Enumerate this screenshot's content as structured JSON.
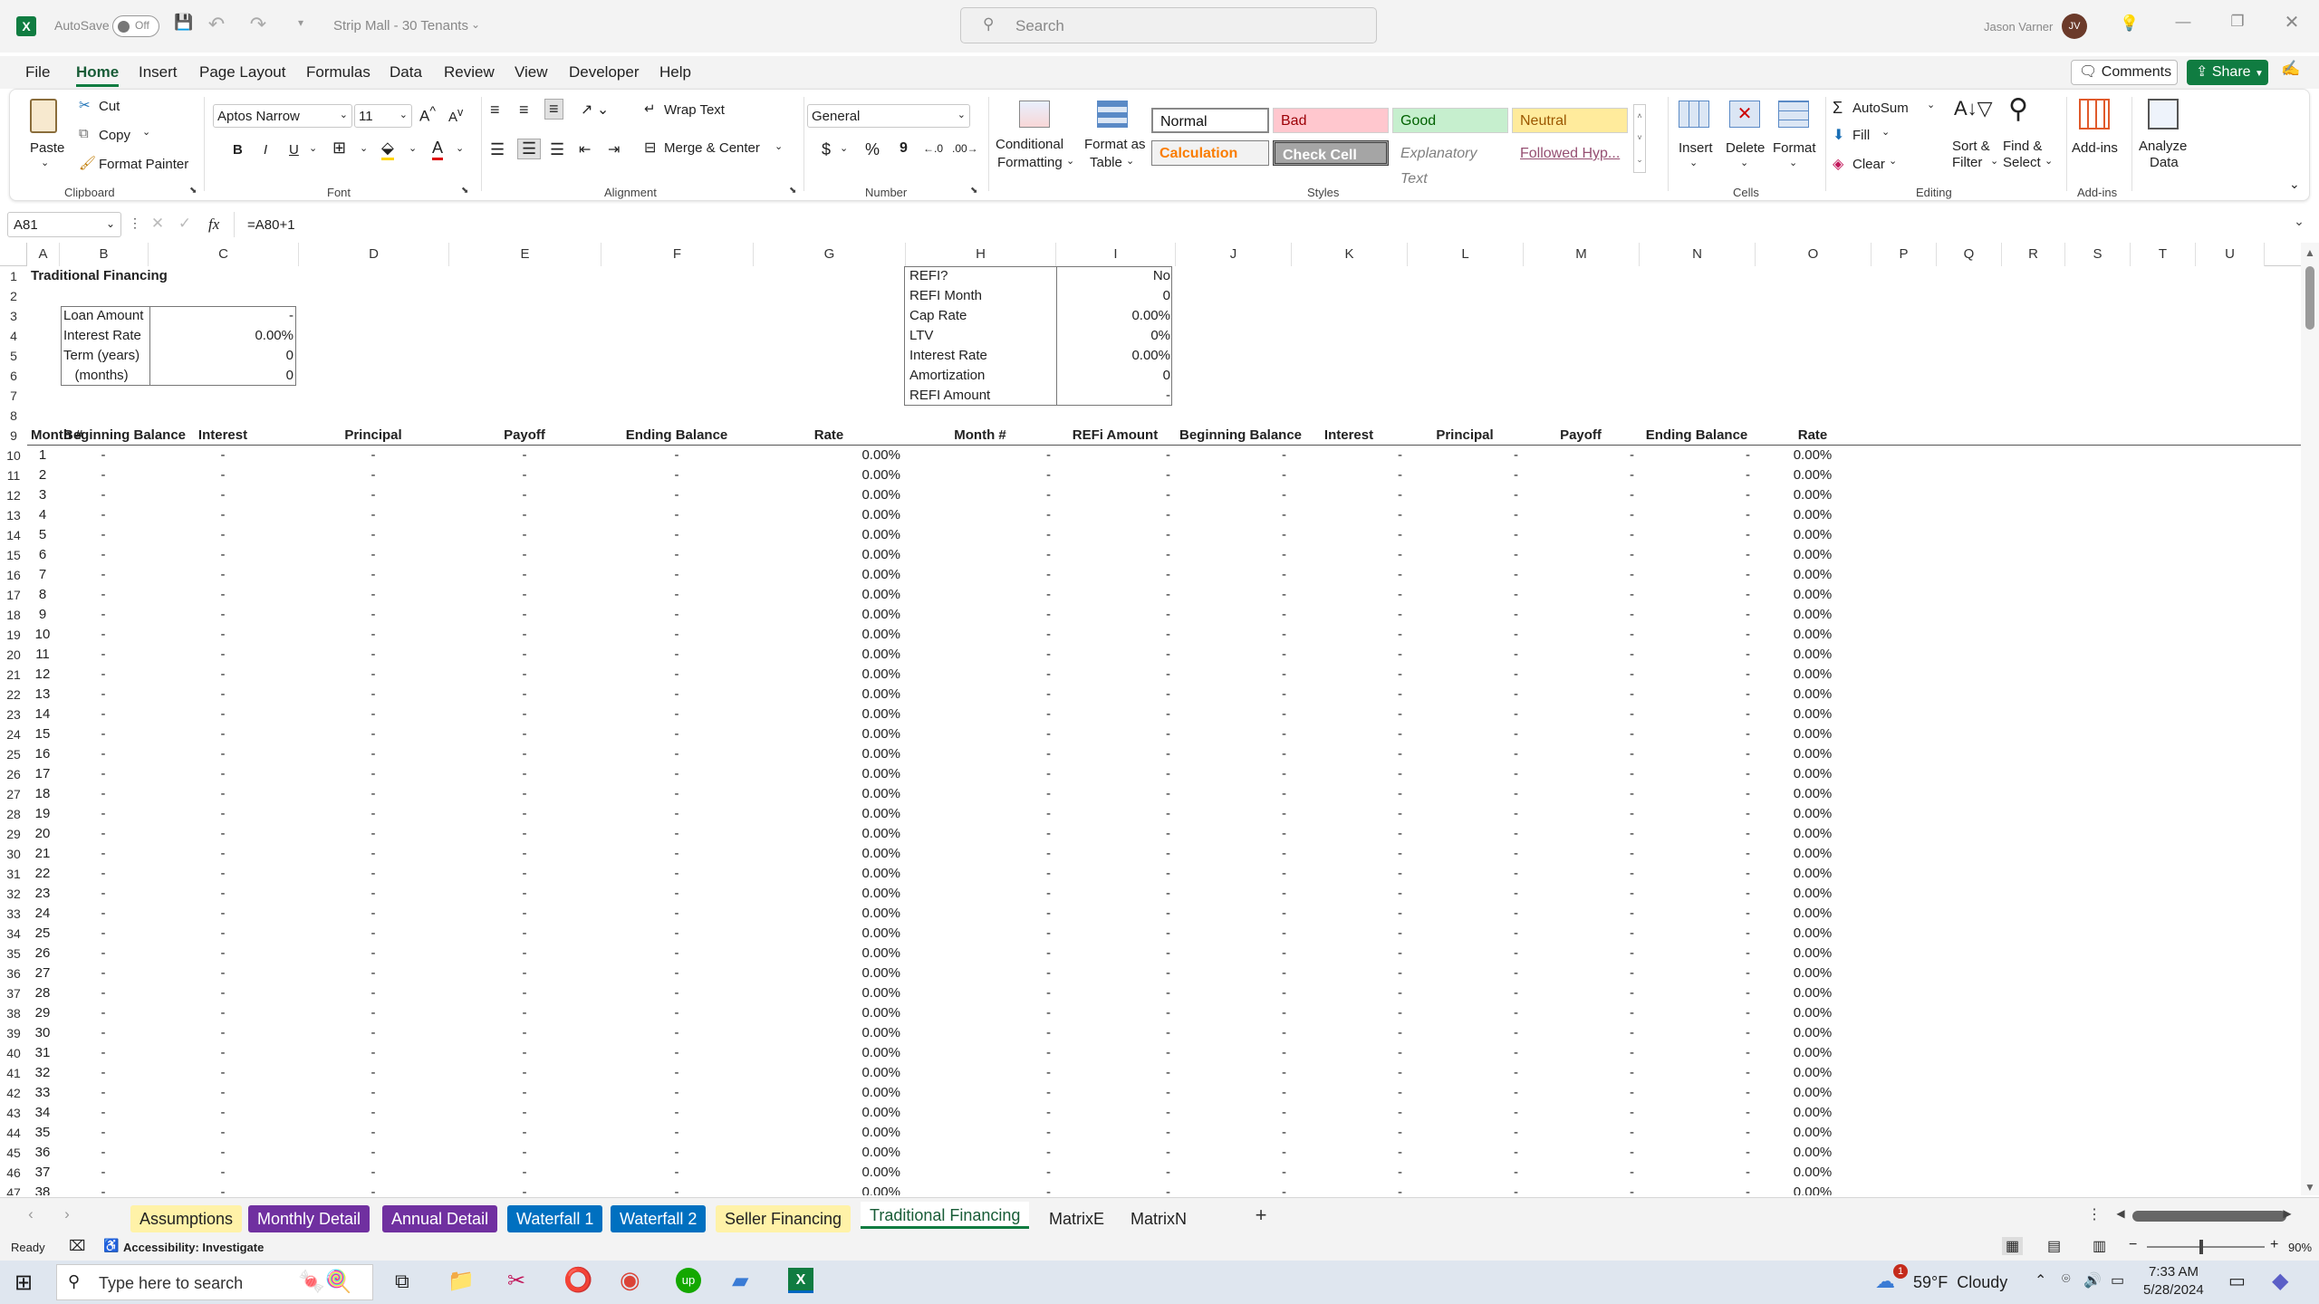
{
  "app": {
    "autosave": "AutoSave",
    "autosave_state": "Off",
    "file_name": "Strip Mall - 30 Tenants",
    "search_placeholder": "Search",
    "user_name": "Jason Varner",
    "user_initials": "JV"
  },
  "menu_tabs": [
    "File",
    "Home",
    "Insert",
    "Page Layout",
    "Formulas",
    "Data",
    "Review",
    "View",
    "Developer",
    "Help"
  ],
  "active_tab": "Home",
  "header_buttons": {
    "comments": "Comments",
    "share": "Share"
  },
  "ribbon": {
    "clipboard": {
      "paste": "Paste",
      "cut": "Cut",
      "copy": "Copy",
      "format_painter": "Format Painter",
      "group": "Clipboard"
    },
    "font": {
      "name": "Aptos Narrow",
      "size": "11",
      "group": "Font",
      "bold": "B",
      "italic": "I",
      "underline": "U"
    },
    "alignment": {
      "wrap": "Wrap Text",
      "merge": "Merge & Center",
      "group": "Alignment"
    },
    "number": {
      "format": "General",
      "currency": "$",
      "percent": "%",
      "comma": "9",
      "group": "Number"
    },
    "styles": {
      "conditional": "Conditional",
      "conditional2": "Formatting",
      "format_table": "Format as",
      "format_table2": "Table",
      "normal": "Normal",
      "bad": "Bad",
      "good": "Good",
      "neutral": "Neutral",
      "calculation": "Calculation",
      "check": "Check Cell",
      "explanatory": "Explanatory Text",
      "followed": "Followed Hyp...",
      "group": "Styles"
    },
    "cells": {
      "insert": "Insert",
      "delete": "Delete",
      "format": "Format",
      "group": "Cells"
    },
    "editing": {
      "autosum": "AutoSum",
      "fill": "Fill",
      "clear": "Clear",
      "sort": "Sort &",
      "sort2": "Filter",
      "find": "Find &",
      "find2": "Select",
      "group": "Editing"
    },
    "addins": {
      "addins": "Add-ins",
      "analyze": "Analyze",
      "analyze2": "Data",
      "group": "Add-ins"
    }
  },
  "formula_bar": {
    "name_box": "A81",
    "fx": "fx",
    "formula": "=A80+1"
  },
  "columns": [
    "A",
    "B",
    "C",
    "D",
    "E",
    "F",
    "G",
    "H",
    "I",
    "J",
    "K",
    "L",
    "M",
    "N",
    "O",
    "P",
    "Q",
    "R",
    "S",
    "T",
    "U"
  ],
  "sheet": {
    "title": "Traditional Financing",
    "loan": [
      [
        "Loan Amount",
        "-"
      ],
      [
        "Interest Rate",
        "0.00%"
      ],
      [
        "Term (years)",
        "0"
      ],
      [
        "   (months)",
        "0"
      ]
    ],
    "refi": [
      [
        "REFI?",
        "No"
      ],
      [
        "REFI Month",
        "0"
      ],
      [
        "Cap Rate",
        "0.00%"
      ],
      [
        "LTV",
        "0%"
      ],
      [
        "Interest Rate",
        "0.00%"
      ],
      [
        "Amortization",
        "0"
      ],
      [
        "REFI Amount",
        "-"
      ]
    ],
    "headers_left": [
      "Month #",
      "Beginning Balance",
      "Interest",
      "Principal",
      "Payoff",
      "Ending Balance",
      "Rate"
    ],
    "headers_right": [
      "Month #",
      "REFi Amount",
      "Beginning Balance",
      "Interest",
      "Principal",
      "Payoff",
      "Ending Balance",
      "Rate"
    ],
    "dash": "-",
    "rate": "0.00%",
    "first_row_number": 10,
    "month_count": 38
  },
  "sheet_tabs": [
    {
      "label": "Assumptions",
      "bg": "#fff2a8",
      "fg": "#222"
    },
    {
      "label": "Monthly Detail",
      "bg": "#7030a0",
      "fg": "#fff"
    },
    {
      "label": "Annual Detail",
      "bg": "#7030a0",
      "fg": "#fff"
    },
    {
      "label": "Waterfall 1",
      "bg": "#0070c0",
      "fg": "#fff"
    },
    {
      "label": "Waterfall 2",
      "bg": "#0070c0",
      "fg": "#fff"
    },
    {
      "label": "Seller Financing",
      "bg": "#fff2a8",
      "fg": "#222"
    },
    {
      "label": "Traditional Financing",
      "bg": "#fff",
      "fg": "#111"
    },
    {
      "label": "MatrixE",
      "bg": "transparent",
      "fg": "#222"
    },
    {
      "label": "MatrixN",
      "bg": "transparent",
      "fg": "#222"
    }
  ],
  "status": {
    "ready": "Ready",
    "accessibility": "Accessibility: Investigate",
    "zoom": "90%"
  },
  "taskbar": {
    "search": "Type here to search",
    "weather": "59°F  Cloudy",
    "time": "7:33 AM",
    "date": "5/28/2024",
    "badge": "1"
  }
}
